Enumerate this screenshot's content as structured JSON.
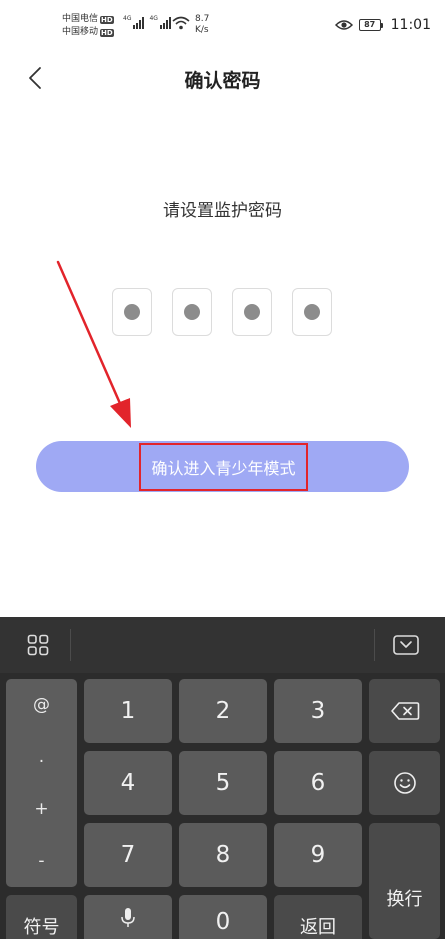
{
  "status_bar": {
    "carrier_1": "中国电信",
    "carrier_2": "中国移动",
    "hd": "HD",
    "network": "4G",
    "speed_value": "8.7",
    "speed_unit": "K/s",
    "battery": "87",
    "time": "11:01"
  },
  "header": {
    "title": "确认密码"
  },
  "content": {
    "subtitle": "请设置监护密码",
    "pin_length": 4,
    "confirm_button_label": "确认进入青少年模式"
  },
  "keyboard": {
    "symbol_keys": [
      "@",
      ".",
      "+",
      "-"
    ],
    "digits": [
      "1",
      "2",
      "3",
      "4",
      "5",
      "6",
      "7",
      "8",
      "9",
      "0"
    ],
    "symbols_key": "符号",
    "return_key": "返回",
    "enter_key": "换行"
  },
  "colors": {
    "accent_button": "#9fa9f4",
    "annotation_red": "#e2242b"
  }
}
